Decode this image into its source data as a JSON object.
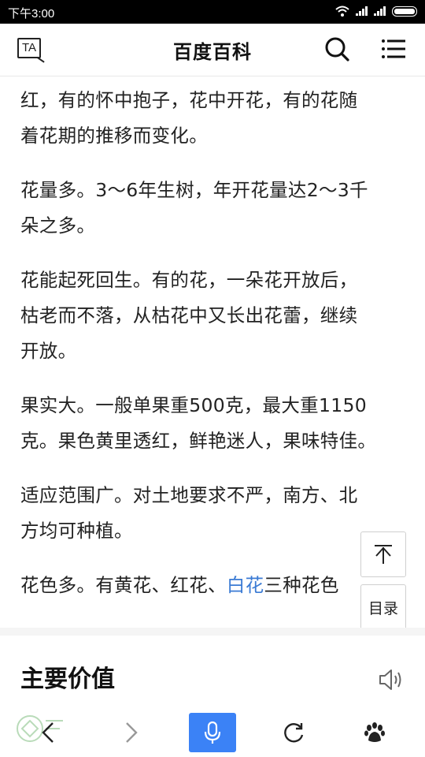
{
  "status_bar": {
    "time": "下午3:00"
  },
  "header": {
    "title": "百度百科",
    "ta_label": "TA"
  },
  "article": {
    "paragraphs": [
      {
        "lines": [
          "红，有的怀中抱子，花中开花，有的花随",
          "着花期的推移而变化。"
        ]
      },
      {
        "lines": [
          "花量多。3～6年生树，年开花量达2～3千",
          "朵之多。"
        ]
      },
      {
        "lines": [
          "花能起死回生。有的花，一朵花开放后，",
          "枯老而不落，从枯花中又长出花蕾，继续",
          "开放。"
        ]
      },
      {
        "lines": [
          "果实大。一般单果重500克，最大重1150",
          "克。果色黄里透红，鲜艳迷人，果味特佳。"
        ]
      },
      {
        "lines": [
          "适应范围广。对土地要求不严，南方、北",
          "方均可种植。"
        ]
      },
      {
        "prefix": "花色多。有黄花、红花、",
        "link": "白花",
        "suffix": "三种花色"
      }
    ]
  },
  "floating": {
    "toc_label": "目录"
  },
  "section": {
    "title": "主要价值"
  },
  "colors": {
    "accent": "#3b82f6",
    "link": "#3b7bd4"
  }
}
